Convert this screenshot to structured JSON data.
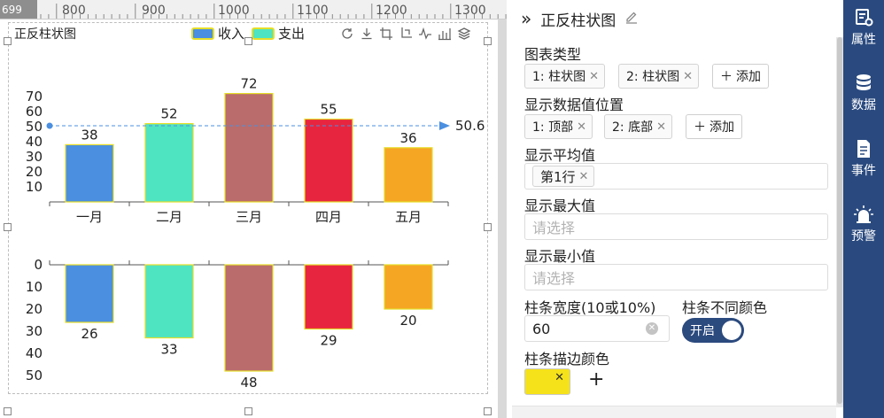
{
  "ruler": {
    "position": "699",
    "ticks": [
      "800",
      "900",
      "1000",
      "1100",
      "1200",
      "1300"
    ]
  },
  "chart": {
    "title": "正反柱状图",
    "legend": [
      {
        "label": "收入",
        "color": "#4a8fe0"
      },
      {
        "label": "支出",
        "color": "#4fe4c1"
      }
    ],
    "toolbox": [
      "restore-icon",
      "download-icon",
      "crop-icon",
      "crop-alt-icon",
      "line-chart-icon",
      "bar-chart-icon",
      "stack-icon"
    ]
  },
  "chart_data": [
    {
      "type": "bar",
      "categories": [
        "一月",
        "二月",
        "三月",
        "四月",
        "五月"
      ],
      "values": [
        38,
        52,
        72,
        55,
        36
      ],
      "bar_colors": [
        "#4a8fe0",
        "#4fe4c1",
        "#b96c6b",
        "#e8253f",
        "#f5a623"
      ],
      "bar_border": "#e6de2a",
      "ylim": [
        0,
        80
      ],
      "yticks": [
        "10",
        "20",
        "30",
        "40",
        "50",
        "60",
        "70"
      ],
      "average_line": {
        "value": 50.6,
        "label": "50.6",
        "color": "#4a8fe0"
      },
      "label_position": "top"
    },
    {
      "type": "bar",
      "categories": [
        "一月",
        "二月",
        "三月",
        "四月",
        "五月"
      ],
      "values": [
        26,
        33,
        48,
        29,
        20
      ],
      "bar_colors": [
        "#4a8fe0",
        "#4fe4c1",
        "#b96c6b",
        "#e8253f",
        "#f5a623"
      ],
      "bar_border": "#e6de2a",
      "ylim": [
        0,
        55
      ],
      "yticks": [
        "0",
        "10",
        "20",
        "30",
        "40",
        "50"
      ],
      "inverse": true,
      "label_position": "bottom"
    }
  ],
  "panel": {
    "title": "正反柱状图",
    "chart_type_label": "图表类型",
    "chart_type_tags": [
      "1: 柱状图",
      "2: 柱状图"
    ],
    "add_label": "添加",
    "value_position_label": "显示数据值位置",
    "value_position_tags": [
      "1: 顶部",
      "2: 底部"
    ],
    "avg_label": "显示平均值",
    "avg_tags": [
      "第1行"
    ],
    "max_label": "显示最大值",
    "max_placeholder": "请选择",
    "min_label": "显示最小值",
    "min_placeholder": "请选择",
    "bar_width_label": "柱条宽度(10或10%)",
    "bar_width_value": "60",
    "diff_color_label": "柱条不同颜色",
    "toggle_label": "开启",
    "border_color_label": "柱条描边颜色",
    "border_color": "#f5e21a"
  },
  "sidebar": {
    "items": [
      {
        "label": "属性",
        "icon": "properties-icon"
      },
      {
        "label": "数据",
        "icon": "database-icon"
      },
      {
        "label": "事件",
        "icon": "event-icon"
      },
      {
        "label": "预警",
        "icon": "alarm-icon"
      }
    ]
  }
}
